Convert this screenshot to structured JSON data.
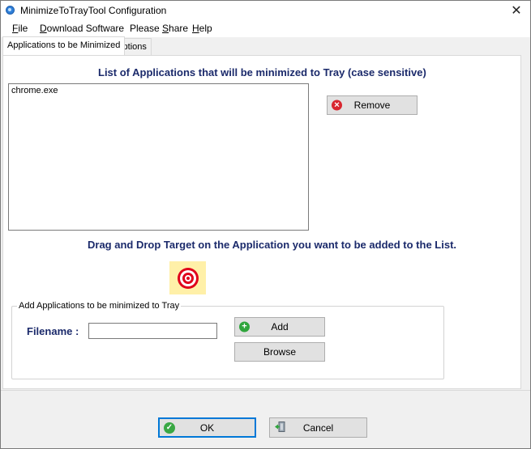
{
  "window": {
    "title": "MinimizeToTrayTool Configuration",
    "close_glyph": "✕",
    "icon": "app-icon"
  },
  "menu": [
    {
      "key": "F",
      "rest": "ile"
    },
    {
      "key": "D",
      "rest": "ownload Software"
    },
    {
      "pre": "Please ",
      "key": "S",
      "rest": "hare"
    },
    {
      "key": "H",
      "rest": "elp"
    }
  ],
  "tabs": [
    {
      "label": "Applications to be Minimized",
      "active": true
    },
    {
      "label": "Options",
      "active": false
    }
  ],
  "main": {
    "list_heading": "List of Applications that will be minimized to Tray (case sensitive)",
    "list_items": [
      "chrome.exe"
    ],
    "remove_label": "Remove",
    "drag_heading": "Drag and Drop Target on the Application you want to be added to the List.",
    "group_title": "Add Applications to be minimized to Tray",
    "filename_label": "Filename :",
    "filename_value": "",
    "add_label": "Add",
    "browse_label": "Browse"
  },
  "footer": {
    "ok_label": "OK",
    "cancel_label": "Cancel"
  },
  "colors": {
    "heading": "#1b2a6b",
    "remove_icon": "#d8262f",
    "add_icon": "#2fa53c",
    "ok_border": "#0078d7",
    "target_bg": "#fff0a8",
    "target_red": "#e0001b"
  }
}
